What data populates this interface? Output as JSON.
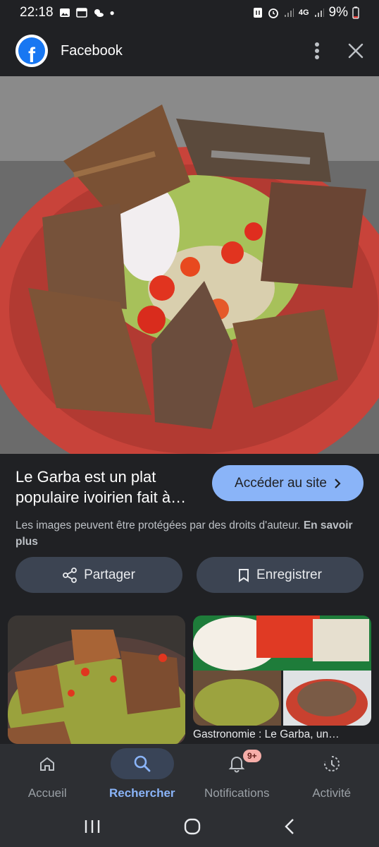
{
  "status_bar": {
    "time": "22:18",
    "network": "4G",
    "battery": "9%"
  },
  "header": {
    "source_name": "Facebook",
    "logo_letter": "f"
  },
  "result": {
    "title_line1": "Le Garba est un plat",
    "title_line2": "populaire ivoirien fait à…",
    "visit_label": "Accéder au site",
    "copyright_text": "Les images peuvent être protégées par des droits d'auteur.",
    "learn_more": "En savoir plus"
  },
  "actions": {
    "share_label": "Partager",
    "save_label": "Enregistrer"
  },
  "related": {
    "right_caption": "Gastronomie : Le Garba, un…"
  },
  "bottom_nav": {
    "items": [
      {
        "label": "Accueil",
        "icon": "home-icon"
      },
      {
        "label": "Rechercher",
        "icon": "search-icon"
      },
      {
        "label": "Notifications",
        "icon": "bell-icon",
        "badge": "9+"
      },
      {
        "label": "Activité",
        "icon": "activity-icon"
      }
    ],
    "active": "Rechercher"
  },
  "colors": {
    "background": "#202124",
    "accent": "#8ab4f8",
    "pill": "#3c4452"
  }
}
